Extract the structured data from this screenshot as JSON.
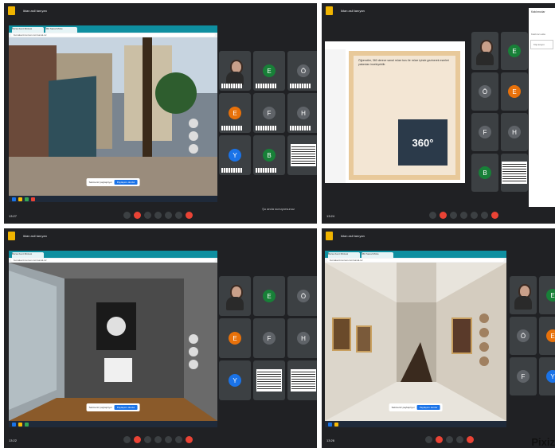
{
  "meeting": {
    "title": "iktan asil tanıyan",
    "time1": "13:27",
    "time2": "13:24",
    "time3": "13:22",
    "time4": "13:26",
    "code": "qdr-hbnv-gba"
  },
  "browser": {
    "tab1": "Bursa Kent Müzesi",
    "tab2": "360 Sanal Müze",
    "url": "bursakentmuzesi.com/sanal-tur"
  },
  "banner": {
    "text": "Sekmeniz paylaşılıyor",
    "button": "Paylaşımı durdur"
  },
  "presenting": "Şu anda sunuyorsunuz",
  "participants": [
    {
      "initial": "E",
      "color": "#188038"
    },
    {
      "initial": "Ö",
      "color": "#5f6368"
    },
    {
      "initial": "E",
      "color": "#e8710a"
    },
    {
      "initial": "F",
      "color": "#5f6368"
    },
    {
      "initial": "H",
      "color": "#5f6368"
    },
    {
      "initial": "Y",
      "color": "#1a73e8"
    },
    {
      "initial": "B",
      "color": "#188038"
    }
  ],
  "slide": {
    "text": "Öğrenciler, 360 derece sanal müze turu ile müze içinde gezinerek eserleri yakından inceleyebilir.",
    "badge": "360°"
  },
  "side_panel": {
    "title": "Katılımcılar",
    "label": "Katılımcı ekle",
    "search": "Kişi arayın"
  },
  "watermark": "Pixiz"
}
